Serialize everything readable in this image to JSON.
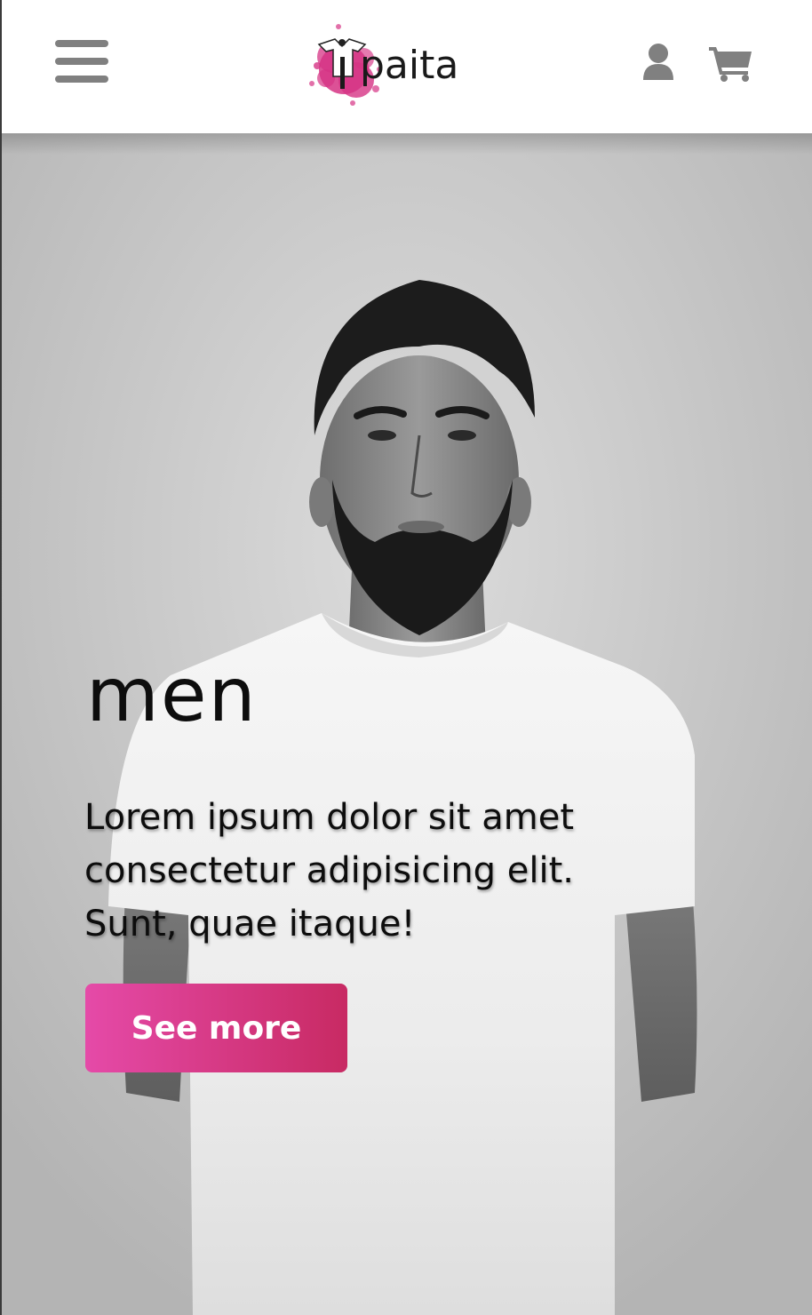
{
  "header": {
    "logo_text": "paita",
    "icons": {
      "menu": "hamburger-menu-icon",
      "user": "user-icon",
      "cart": "shopping-cart-icon"
    }
  },
  "hero": {
    "title": "men",
    "description": "Lorem ipsum dolor sit amet consectetur adipisicing elit. Sunt, quae itaque!",
    "button_label": "See more",
    "image": "black-and-white photo of bearded man in white t-shirt"
  },
  "colors": {
    "accent_start": "#e54aa8",
    "accent_end": "#c82a63",
    "icon_gray": "#808080",
    "logo_splash": "#d63384"
  }
}
